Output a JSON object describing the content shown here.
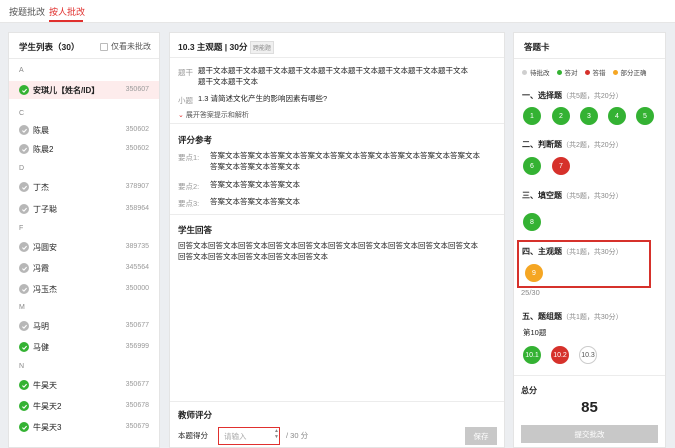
{
  "tabs": [
    {
      "label": "按题批改",
      "active": false
    },
    {
      "label": "按人批改",
      "active": true
    }
  ],
  "left": {
    "title": "学生列表（30）",
    "filter_label": "仅看未批改",
    "groups": [
      {
        "letter": "A",
        "students": [
          {
            "name": "安琪儿【姓名/ID】",
            "id": "350607",
            "graded": true,
            "active": true
          }
        ]
      },
      {
        "letter": "C",
        "students": [
          {
            "name": "陈晨",
            "id": "350602",
            "graded": false
          },
          {
            "name": "陈晨2",
            "id": "350602",
            "graded": false
          }
        ]
      },
      {
        "letter": "D",
        "students": [
          {
            "name": "丁杰",
            "id": "378907",
            "graded": false
          },
          {
            "name": "丁子聪",
            "id": "358964",
            "graded": false
          }
        ]
      },
      {
        "letter": "F",
        "students": [
          {
            "name": "冯圆安",
            "id": "389735",
            "graded": false
          },
          {
            "name": "冯霞",
            "id": "345564",
            "graded": false
          },
          {
            "name": "冯玉杰",
            "id": "350000",
            "graded": false
          }
        ]
      },
      {
        "letter": "M",
        "students": [
          {
            "name": "马明",
            "id": "350677",
            "graded": false
          },
          {
            "name": "马健",
            "id": "356999",
            "graded": true
          }
        ]
      },
      {
        "letter": "N",
        "students": [
          {
            "name": "牛昊天",
            "id": "350677",
            "graded": true
          },
          {
            "name": "牛昊天2",
            "id": "350678",
            "graded": true
          },
          {
            "name": "牛昊天3",
            "id": "350679",
            "graded": true
          }
        ]
      }
    ]
  },
  "mid": {
    "question_title": "10.3 主观题 | 30分",
    "badge": "跨能题",
    "stem_label": "题干",
    "stem_line1": "题干文本题干文本题干文本题干文本题干文本题干文本题干文本题干文本题干文本",
    "stem_line2": "题干文本题干文本",
    "sub_label": "小题",
    "sub_text": "1.3 请简述文化产生的影响因素有哪些?",
    "expand_label": "展开答案提示和解析",
    "ref_title": "评分参考",
    "points": [
      {
        "label": "要点1:",
        "line1": "答案文本答案文本答案文本答案文本答案文本答案文本答案文本答案文本答案文本",
        "line2": "答案文本答案文本答案文本"
      },
      {
        "label": "要点2:",
        "line1": "答案文本答案文本答案文本",
        "line2": ""
      },
      {
        "label": "要点3:",
        "line1": "答案文本答案文本答案文本",
        "line2": ""
      }
    ],
    "answer_title": "学生回答",
    "answer_line1": "回答文本回答文本回答文本回答文本回答文本回答文本回答文本回答文本回答文本回答文本",
    "answer_line2": "回答文本回答文本回答文本回答文本回答文本",
    "teacher_title": "教师评分",
    "score_label": "本题得分",
    "score_placeholder": "请输入",
    "score_total": "/ 30 分",
    "save_label": "保存"
  },
  "right": {
    "title": "答题卡",
    "legend": [
      {
        "label": "待批改",
        "color": "#cfcfcf"
      },
      {
        "label": "答对",
        "color": "#34b233"
      },
      {
        "label": "答错",
        "color": "#d6312b"
      },
      {
        "label": "部分正确",
        "color": "#f5a623"
      }
    ],
    "sections": [
      {
        "title": "一、选择题",
        "sub": "（共5题，共20分）"
      },
      {
        "title": "二、判断题",
        "sub": "（共2题，共20分）"
      },
      {
        "title": "三、填空题",
        "sub": "（共5题，共30分）"
      },
      {
        "title": "四、主观题",
        "sub": "（共1题，共30分）"
      },
      {
        "title": "五、题组题",
        "sub": "（共1题，共30分）"
      }
    ],
    "choice": [
      "1",
      "2",
      "3",
      "4",
      "5"
    ],
    "judge": [
      "6",
      "7"
    ],
    "fill": [
      "8"
    ],
    "subjective": [
      "9"
    ],
    "subjective_score": "25/30",
    "group_label": "第10题",
    "group": [
      "10.1",
      "10.2",
      "10.3"
    ],
    "total_label": "总分",
    "total_value": "85",
    "submit_label": "提交批改"
  }
}
